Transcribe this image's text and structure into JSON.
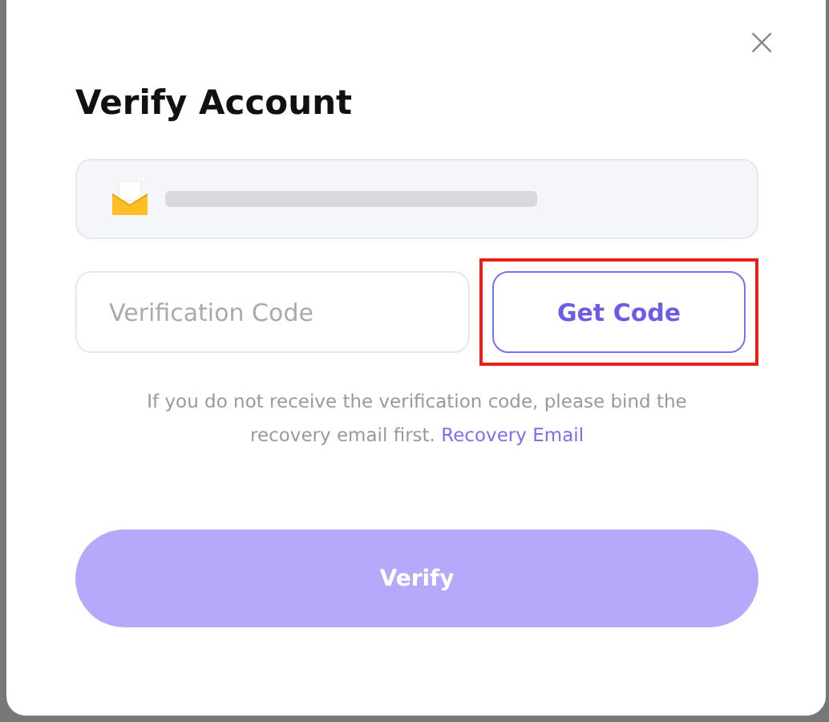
{
  "dialog": {
    "title": "Verify Account",
    "close_icon": "×"
  },
  "email_field": {
    "redacted": true
  },
  "code_field": {
    "placeholder": "Verification Code"
  },
  "get_code_button": {
    "label": "Get Code",
    "highlighted": true
  },
  "help_text": {
    "text": "If you do not receive the verification code, please bind the recovery email first.",
    "link": "Recovery Email"
  },
  "verify_button": {
    "label": "Verify",
    "disabled": true
  }
}
